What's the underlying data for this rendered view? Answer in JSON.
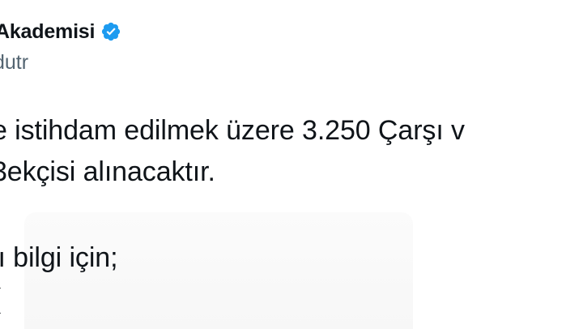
{
  "tweet": {
    "author_name": "Akademisi",
    "author_handle": "dutr",
    "verified_icon": "verified-badge-icon",
    "accent_color": "#1d9bf0",
    "text_lines": [
      "e istihdam edilmek üzere 3.250 Çarşı v",
      "3ekçisi alınacaktır.",
      "lı bilgi için;",
      "("
    ]
  }
}
